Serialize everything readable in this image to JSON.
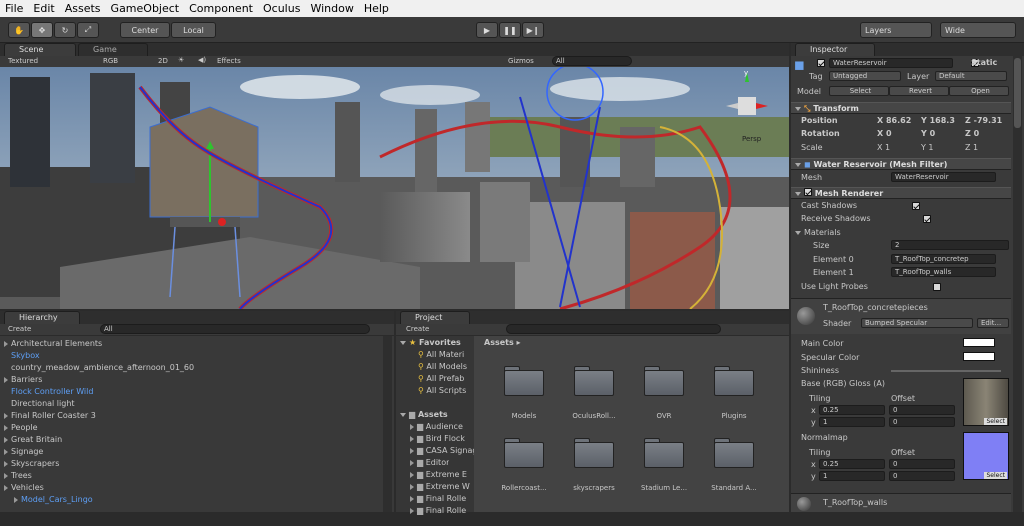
{
  "menu": [
    "File",
    "Edit",
    "Assets",
    "GameObject",
    "Component",
    "Oculus",
    "Window",
    "Help"
  ],
  "toolbar": {
    "center": "Center",
    "local": "Local",
    "layers": "Layers",
    "layout": "Wide"
  },
  "scene": {
    "tab": "Scene",
    "game_tab": "Game",
    "shading": "Textured",
    "rgb": "RGB",
    "mode2d": "2D",
    "effects": "Effects",
    "gizmos": "Gizmos",
    "search": "All",
    "gizmo_label": "Persp",
    "axis_y": "y"
  },
  "hierarchy": {
    "tab": "Hierarchy",
    "create": "Create",
    "search": "All",
    "items": [
      {
        "label": "Architectural Elements",
        "tri": true,
        "indent": 0,
        "blue": false
      },
      {
        "label": "Skybox",
        "tri": false,
        "indent": 0,
        "blue": true
      },
      {
        "label": "country_meadow_ambience_afternoon_01_60",
        "tri": false,
        "indent": 0,
        "blue": false
      },
      {
        "label": "Barriers",
        "tri": true,
        "indent": 0,
        "blue": false
      },
      {
        "label": "Flock Controller Wild",
        "tri": false,
        "indent": 0,
        "blue": true
      },
      {
        "label": "Directional light",
        "tri": false,
        "indent": 0,
        "blue": false
      },
      {
        "label": "Final Roller Coaster 3",
        "tri": true,
        "indent": 0,
        "blue": false
      },
      {
        "label": "People",
        "tri": true,
        "indent": 0,
        "blue": false
      },
      {
        "label": "Great Britain",
        "tri": true,
        "indent": 0,
        "blue": false
      },
      {
        "label": "Signage",
        "tri": true,
        "indent": 0,
        "blue": false
      },
      {
        "label": "Skyscrapers",
        "tri": true,
        "indent": 0,
        "blue": false
      },
      {
        "label": "Trees",
        "tri": true,
        "indent": 0,
        "blue": false
      },
      {
        "label": "Vehicles",
        "tri": true,
        "indent": 0,
        "blue": false
      },
      {
        "label": "Model_Cars_Lingo",
        "tri": true,
        "indent": 1,
        "blue": true
      }
    ]
  },
  "project": {
    "tab": "Project",
    "create": "Create",
    "favorites": "Favorites",
    "fav_items": [
      "All Materi",
      "All Models",
      "All Prefab",
      "All Scripts"
    ],
    "assets": "Assets",
    "asset_tree": [
      "Audience",
      "Bird Flock",
      "CASA Signage",
      "Editor",
      "Extreme E",
      "Extreme W",
      "Final Rolle",
      "Final Rolle"
    ],
    "breadcrumb": "Assets",
    "folders": [
      "Models",
      "OculusRoll...",
      "OVR",
      "Plugins",
      "Rollercoast...",
      "skyscrapers",
      "Stadium Le...",
      "Standard A..."
    ]
  },
  "inspector": {
    "tab": "Inspector",
    "name": "WaterReservoir",
    "static": "Static",
    "tag_label": "Tag",
    "tag": "Untagged",
    "layer_label": "Layer",
    "layer": "Default",
    "model_label": "Model",
    "select": "Select",
    "revert": "Revert",
    "open": "Open",
    "transform": {
      "title": "Transform",
      "position": "Position",
      "rotation": "Rotation",
      "scale": "Scale",
      "pos": [
        "X 86.62",
        "Y 168.3",
        "Z -79.31"
      ],
      "rot": [
        "X 0",
        "Y 0",
        "Z 0"
      ],
      "scl": [
        "X 1",
        "Y 1",
        "Z 1"
      ]
    },
    "meshfilter": {
      "title": "Water Reservoir (Mesh Filter)",
      "mesh_label": "Mesh",
      "mesh": "WaterReservoir"
    },
    "renderer": {
      "title": "Mesh Renderer",
      "cast": "Cast Shadows",
      "receive": "Receive Shadows",
      "materials": "Materials",
      "size_label": "Size",
      "size": "2",
      "e0_label": "Element 0",
      "e0": "T_RoofTop_concretep",
      "e1_label": "Element 1",
      "e1": "T_RoofTop_walls",
      "probes": "Use Light Probes"
    },
    "material": {
      "name": "T_RoofTop_concretepieces",
      "shader_label": "Shader",
      "shader": "Bumped Specular",
      "edit": "Edit...",
      "main_color": "Main Color",
      "spec_color": "Specular Color",
      "shininess": "Shininess",
      "base": "Base (RGB) Gloss (A)",
      "tiling": "Tiling",
      "offset": "Offset",
      "x": "x",
      "y": "y",
      "tx": "0.25",
      "ty": "1",
      "ox": "0",
      "oy": "0",
      "select": "Select",
      "normalmap": "Normalmap",
      "ntx": "0.25",
      "nty": "1",
      "nox": "0",
      "noy": "0"
    },
    "material2": "T_RoofTop_walls"
  },
  "colors": {
    "normal_swatch": "#7f7ff5",
    "blue_text": "#5e9ff5"
  }
}
